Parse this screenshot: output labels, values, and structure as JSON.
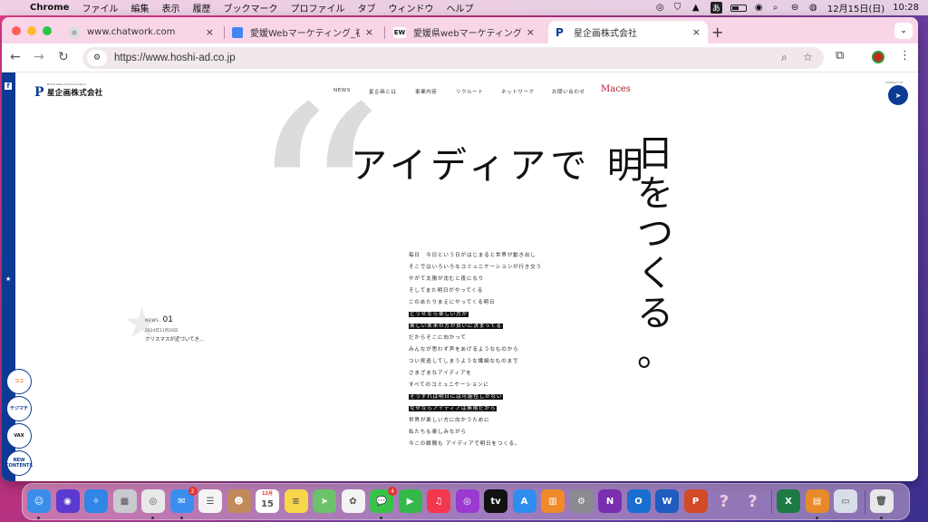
{
  "menubar": {
    "app": "Chrome",
    "items": [
      "ファイル",
      "編集",
      "表示",
      "履歴",
      "ブックマーク",
      "プロファイル",
      "タブ",
      "ウィンドウ",
      "ヘルプ"
    ],
    "date": "12月15日(日)",
    "time": "10:28",
    "input_indicator": "あ"
  },
  "tabs": [
    {
      "title": "www.chatwork.com",
      "favicon": "chatwork-icon",
      "active": false
    },
    {
      "title": "愛媛Webマーケティング_初稿 - ",
      "favicon": "google-docs-icon",
      "active": false
    },
    {
      "title": "愛媛県webマーケティング会社お",
      "favicon": "ew-icon",
      "active": false
    },
    {
      "title": "星企画株式会社",
      "favicon": "hoshi-logo-icon",
      "active": true
    }
  ],
  "omnibox": {
    "url": "https://www.hoshi-ad.co.jp"
  },
  "site": {
    "logo_text": "星企画株式会社",
    "logo_sub": "Brand Value Communication",
    "nav": [
      "NEWS",
      "星企画とは",
      "事業内容",
      "リクルート",
      "ネットワーク",
      "お問い合わせ"
    ],
    "maces": "Maces",
    "contact_label": "CONTACT US",
    "headline": "アイディアで 明",
    "vertical": [
      "日",
      "を",
      "つ",
      "く",
      "る",
      "。"
    ],
    "poem": [
      {
        "text": "毎日　今日という日がはじまると世界が動き出し",
        "hl": false
      },
      {
        "text": "そこではいろいろなコミュニケーションが行き交う",
        "hl": false
      },
      {
        "text": "やがて太陽が沈むと夜になり",
        "hl": false
      },
      {
        "text": "そしてまた明日がやってくる",
        "hl": false
      },
      {
        "text": "このあたりまえにやってくる明日",
        "hl": false
      },
      {
        "text": "どうせなら楽しい方が",
        "hl": true
      },
      {
        "text": "楽しい未来の方が良いに決まってる",
        "hl": true
      },
      {
        "text": "だからそこに向かって",
        "hl": false
      },
      {
        "text": "みんなが思わず声をあげるようなものから",
        "hl": false
      },
      {
        "text": "つい見逃してしまうような繊細なものまで",
        "hl": false
      },
      {
        "text": "さまざまなアイディアを",
        "hl": false
      },
      {
        "text": "すべてのコミュニケーションに",
        "hl": false
      },
      {
        "text": "そうすれば明日には可能性しかない",
        "hl": true
      },
      {
        "text": "なぜならアイディアは無限だから",
        "hl": true
      },
      {
        "text": "世界が楽しい方に向かうために",
        "hl": false
      },
      {
        "text": "私たちも楽しみながら",
        "hl": false
      },
      {
        "text": "今この瞬間も アイディアで明日をつくる。",
        "hl": false
      }
    ],
    "news": {
      "label": "NEWS",
      "number": "01",
      "date": "2024年11月20日",
      "title": "クリスマスが近づいてき…"
    },
    "badges": [
      "ココ",
      "テジマチ",
      "VAX",
      "NEW CONTENTS"
    ]
  },
  "dock": {
    "items": [
      {
        "name": "finder-icon",
        "color": "#3b8ee8",
        "glyph": "☺"
      },
      {
        "name": "siri-icon",
        "color": "#5a3ad0",
        "glyph": "◉"
      },
      {
        "name": "safari-icon",
        "color": "#2f86e6",
        "glyph": "✧"
      },
      {
        "name": "launchpad-icon",
        "color": "#c9c9d0",
        "glyph": "▦"
      },
      {
        "name": "chrome-icon",
        "color": "#e8e8e8",
        "glyph": "◎"
      },
      {
        "name": "mail-icon",
        "color": "#3a8ef0",
        "glyph": "✉",
        "badge": "2"
      },
      {
        "name": "reminders-icon",
        "color": "#f4f4f4",
        "glyph": "☰"
      },
      {
        "name": "contacts-icon",
        "color": "#c08a5a",
        "glyph": "☻"
      },
      {
        "name": "calendar-icon",
        "color": "#ffffff",
        "glyph": "15",
        "caption": "12月"
      },
      {
        "name": "notes-icon",
        "color": "#f7d64a",
        "glyph": "≡"
      },
      {
        "name": "maps-icon",
        "color": "#6cc26a",
        "glyph": "➤"
      },
      {
        "name": "photos-icon",
        "color": "#f3f3f3",
        "glyph": "✿"
      },
      {
        "name": "messages-icon",
        "color": "#38c24a",
        "glyph": "💬",
        "badge": "4"
      },
      {
        "name": "facetime-icon",
        "color": "#35b84a",
        "glyph": "▶"
      },
      {
        "name": "music-icon",
        "color": "#f3384e",
        "glyph": "♫"
      },
      {
        "name": "podcasts-icon",
        "color": "#9a3ad0",
        "glyph": "◎"
      },
      {
        "name": "appletv-icon",
        "color": "#111111",
        "glyph": "tv"
      },
      {
        "name": "appstore-icon",
        "color": "#2f8df0",
        "glyph": "A"
      },
      {
        "name": "books-icon",
        "color": "#f08a2a",
        "glyph": "▥"
      },
      {
        "name": "settings-icon",
        "color": "#8a8a90",
        "glyph": "⚙"
      },
      {
        "name": "onenote-icon",
        "color": "#7a2fb0",
        "glyph": "N"
      },
      {
        "name": "outlook-icon",
        "color": "#1a6ed0",
        "glyph": "O"
      },
      {
        "name": "word-icon",
        "color": "#1f5cc0",
        "glyph": "W"
      },
      {
        "name": "powerpoint-icon",
        "color": "#d24a26",
        "glyph": "P"
      },
      {
        "name": "unknown-app-icon",
        "color": "transparent",
        "glyph": "?"
      },
      {
        "name": "unknown-app-icon-2",
        "color": "transparent",
        "glyph": "?"
      },
      {
        "name": "excel-icon",
        "color": "#1d7a44",
        "glyph": "X"
      },
      {
        "name": "app-folder-icon",
        "color": "#e88a2a",
        "glyph": "▤"
      },
      {
        "name": "preview-icon",
        "color": "#d8dde8",
        "glyph": "▭"
      },
      {
        "name": "trash-icon",
        "color": "#e8e8ea",
        "glyph": "🗑"
      }
    ]
  }
}
